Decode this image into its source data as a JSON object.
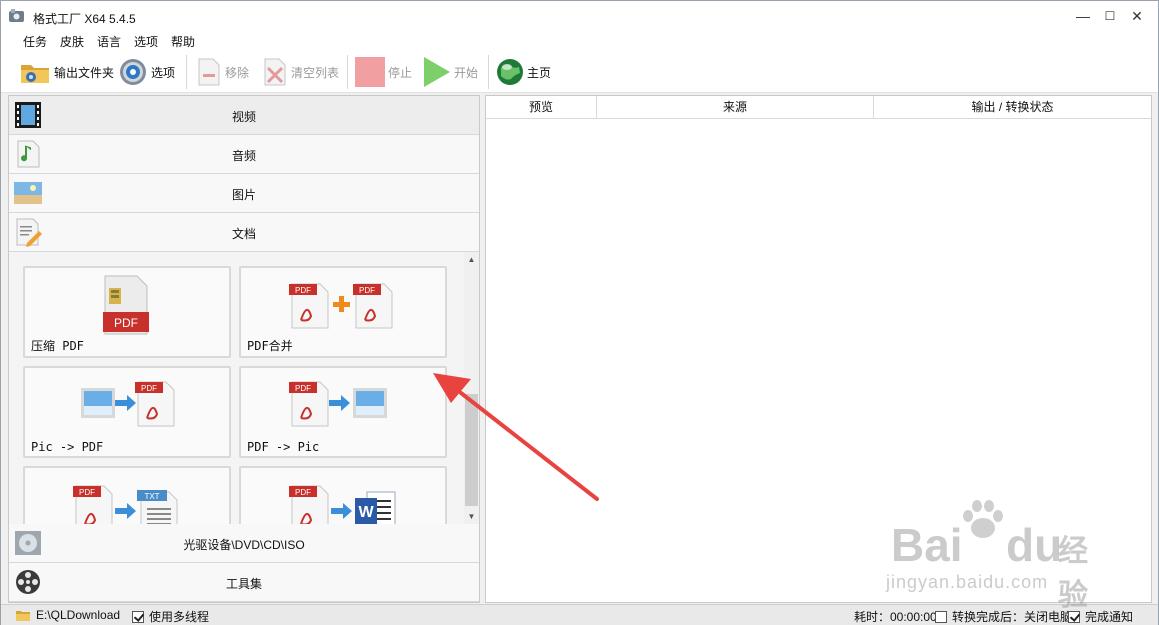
{
  "window": {
    "title": "格式工厂 X64 5.4.5",
    "min_glyph": "—",
    "max_glyph": "☐",
    "close_glyph": "✕"
  },
  "menu": [
    "任务",
    "皮肤",
    "语言",
    "选项",
    "帮助"
  ],
  "toolbar": {
    "output_folder": "输出文件夹",
    "options": "选项",
    "remove": "移除",
    "clear_list": "清空列表",
    "stop": "停止",
    "start": "开始",
    "home": "主页"
  },
  "categories": {
    "video": "视频",
    "audio": "音频",
    "image": "图片",
    "document": "文档",
    "optical": "光驱设备\\DVD\\CD\\ISO",
    "tools": "工具集"
  },
  "tiles": {
    "compress_pdf": "压缩 PDF",
    "merge_pdf": "PDF合并",
    "pic_to_pdf": "Pic -> PDF",
    "pdf_to_pic": "PDF -> Pic",
    "pdf_badge": "PDF",
    "txt_badge": "TXT",
    "word_badge": "W"
  },
  "columns": [
    "预览",
    "来源",
    "输出 / 转换状态"
  ],
  "status": {
    "path": "E:\\QLDownload",
    "multithread": "使用多线程",
    "multithread_checked": true,
    "elapsed": "耗时：00:00:00",
    "after_convert": "转换完成后：关闭电脑",
    "after_convert_checked": false,
    "notify": "完成通知",
    "notify_checked": true
  },
  "watermark": {
    "brand_a": "Bai",
    "brand_b": "du",
    "brand_cn": "经验",
    "site": "jingyan.baidu.com"
  },
  "colors": {
    "accent_red": "#e8433f",
    "pdf_red": "#c8302c",
    "start_green": "#7ccf6a",
    "stop_red": "#f0a0a0"
  }
}
